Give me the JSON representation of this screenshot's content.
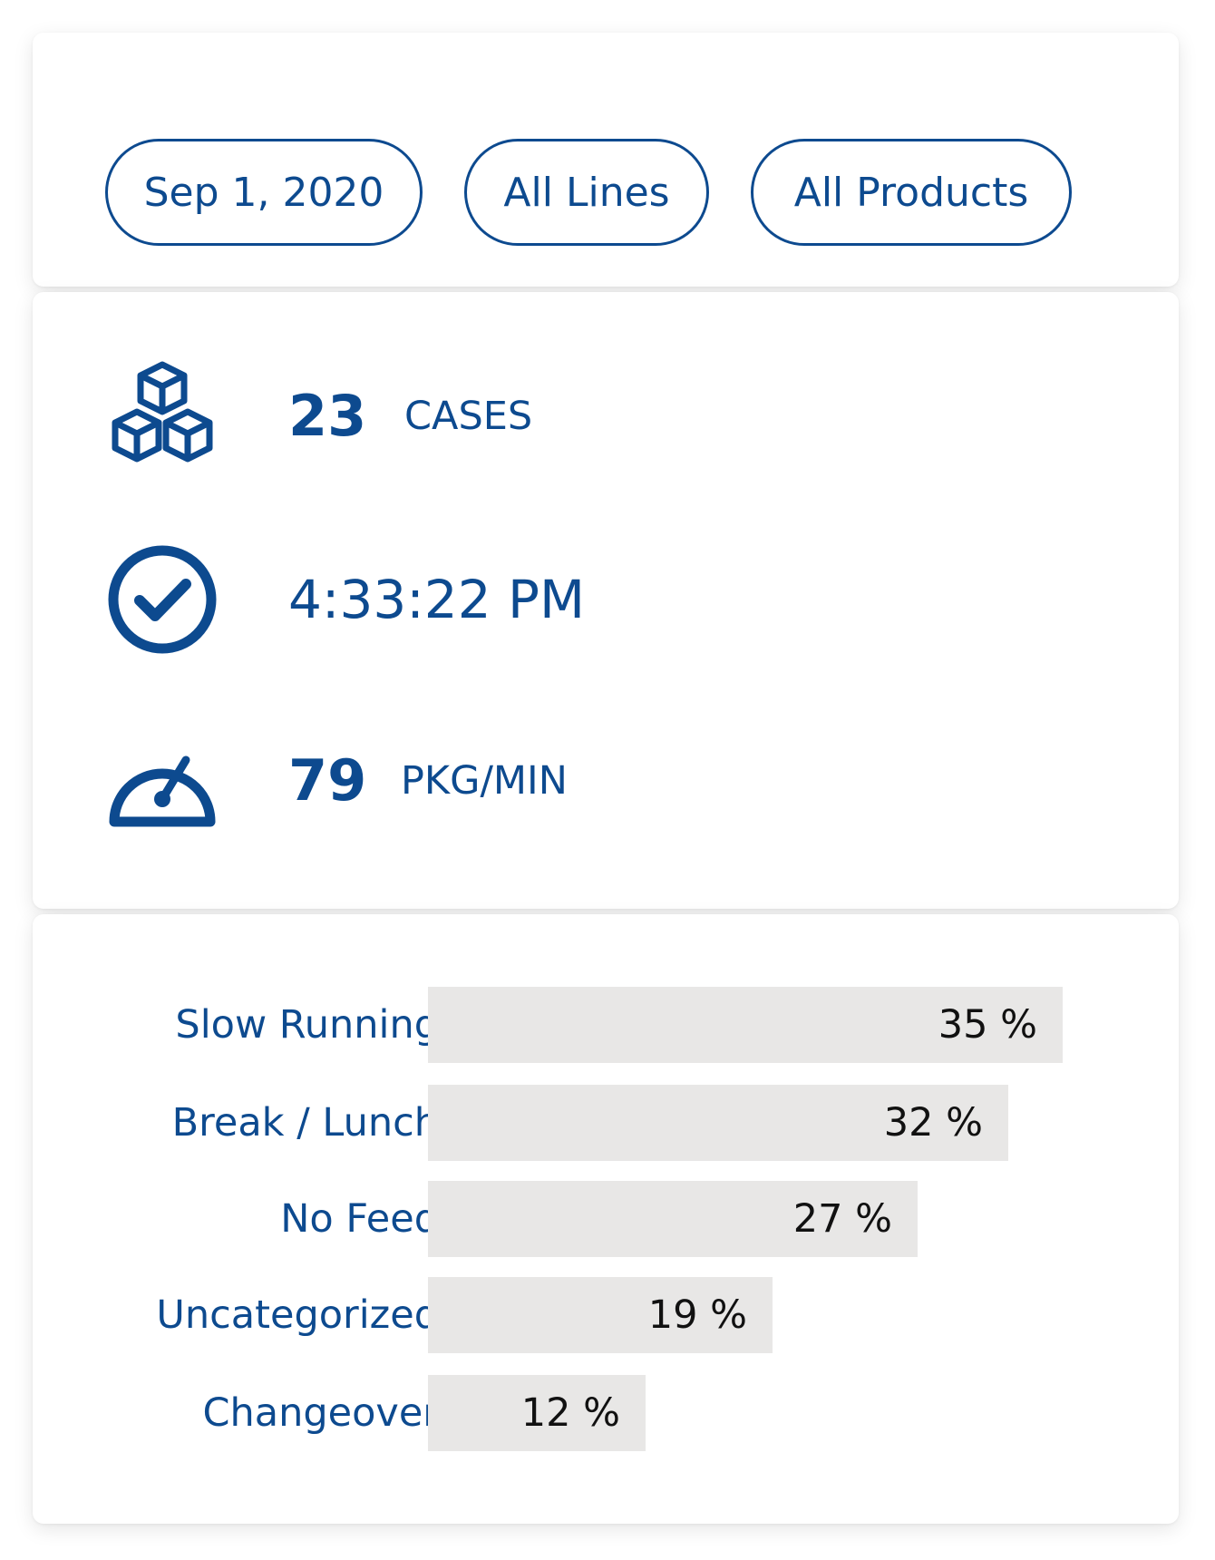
{
  "filters": {
    "date": "Sep 1, 2020",
    "lines": "All Lines",
    "products": "All Products"
  },
  "stats": {
    "cases": {
      "icon": "cubes-icon",
      "value": "23",
      "unit": "CASES"
    },
    "time": {
      "icon": "check-circle-icon",
      "value": "4:33:22 PM"
    },
    "speed": {
      "icon": "speedometer-icon",
      "value": "79",
      "unit": "PKG/MIN"
    }
  },
  "reasons": [
    {
      "label": "Slow Running",
      "percent": 35,
      "display": "35 %"
    },
    {
      "label": "Break / Lunch",
      "percent": 32,
      "display": "32 %"
    },
    {
      "label": "No Feed",
      "percent": 27,
      "display": "27 %"
    },
    {
      "label": "Uncategorized",
      "percent": 19,
      "display": "19 %"
    },
    {
      "label": "Changeover",
      "percent": 12,
      "display": "12 %"
    }
  ],
  "colors": {
    "accent": "#0d4a8f",
    "bar": "#e8e7e6",
    "bar_text": "#111111"
  }
}
